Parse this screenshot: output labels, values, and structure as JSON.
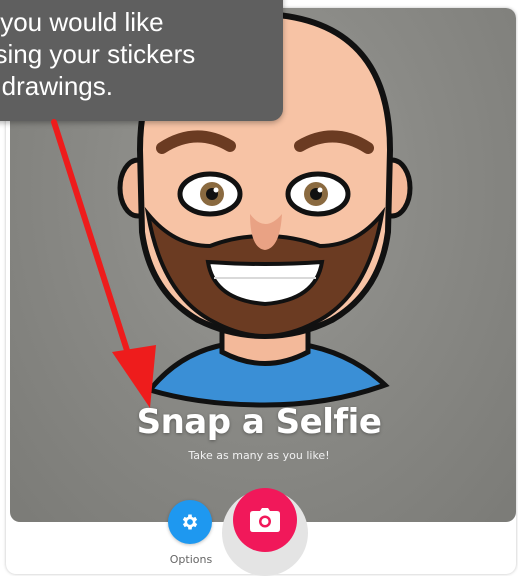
{
  "tooltip": {
    "lines": [
      "s you would like",
      "osing your stickers",
      "d drawings."
    ]
  },
  "preview": {
    "title": "Snap a Selfie",
    "subtitle": "Take as many as you like!"
  },
  "controls": {
    "options_label": "Options",
    "options_icon": "gear-icon",
    "capture_icon": "camera-icon"
  },
  "colors": {
    "preview_bg": "#8a8a86",
    "options": "#1e98f0",
    "capture": "#f1185a",
    "tooltip": "#5f5f5f",
    "arrow": "#ee1c1c"
  }
}
